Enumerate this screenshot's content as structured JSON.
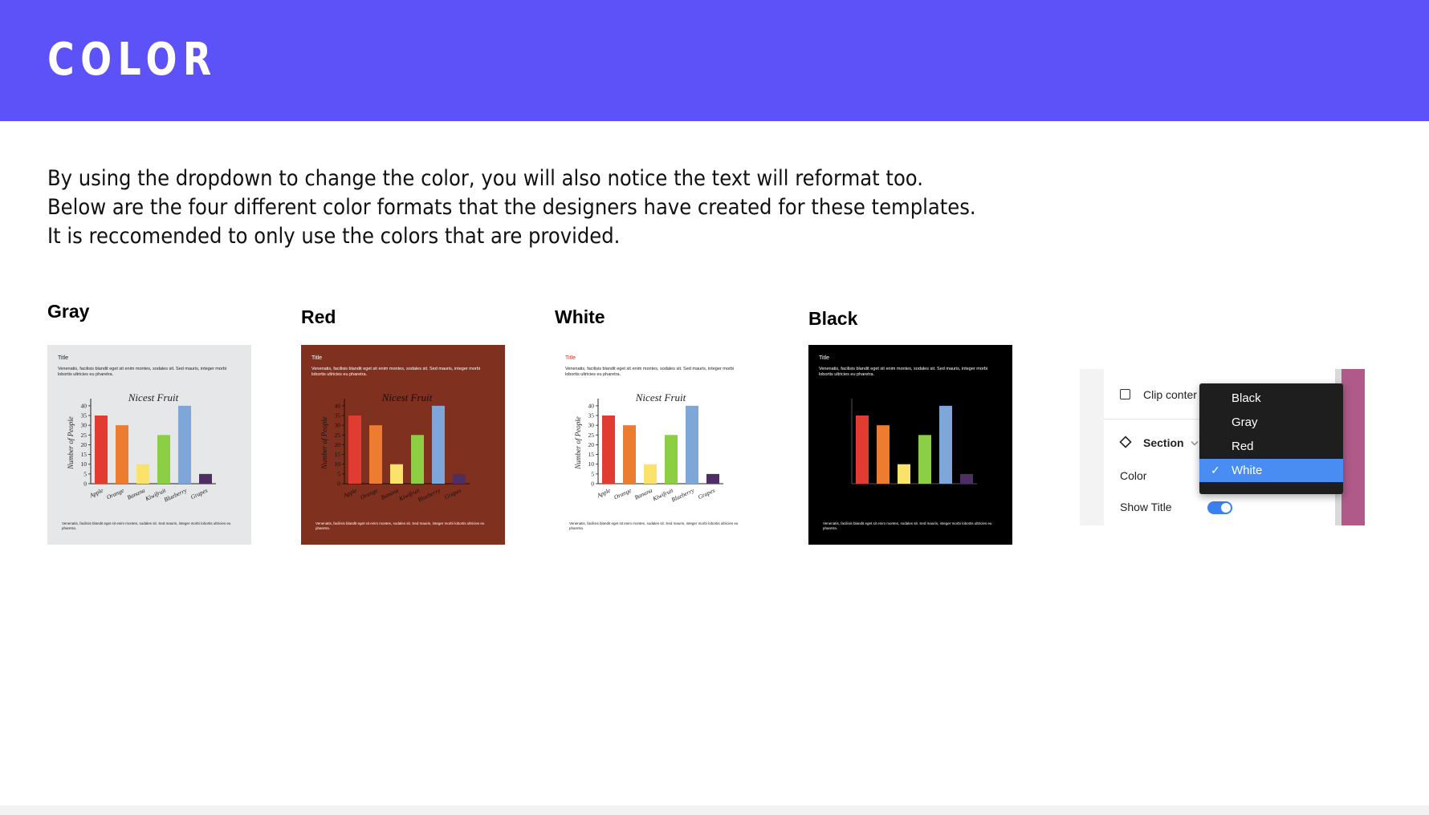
{
  "header": {
    "title": "COLOR",
    "background": "#5c52f7"
  },
  "intro": {
    "lines": [
      "By using the dropdown to change the color, you will also notice the text will reformat too.",
      "Below are the four different color formats that the designers have created for these templates.",
      "It is reccomended to only use the colors that are provided."
    ]
  },
  "variants": [
    {
      "label": "Gray",
      "background": "#e6e7e8",
      "text_color": "#222222",
      "title_color": "#222222",
      "axis_color": "#222222",
      "show_axis_labels": true
    },
    {
      "label": "Red",
      "background": "#80301f",
      "text_color": "#ffffff",
      "title_color": "#ffffff",
      "axis_color": "#1a0a05",
      "show_axis_labels": true
    },
    {
      "label": "White",
      "background": "#ffffff",
      "text_color": "#222222",
      "title_color": "#d9342b",
      "axis_color": "#222222",
      "show_axis_labels": true
    },
    {
      "label": "Black",
      "background": "#000000",
      "text_color": "#ffffff",
      "title_color": "#ffffff",
      "axis_color": "#555555",
      "show_axis_labels": false
    }
  ],
  "card_text": {
    "title": "Title",
    "description": "Venenatis, facilisis blandit eget sit enim montes, sodales sit. Sed mauris, integer morbi lobortis ultricies eu pharetra.",
    "footer": "Venenatis, facilisis blandit eget sit enim montes, sodales sit. Sed mauris, integer morbi lobortis ultricies eu pharetra."
  },
  "chart_data": {
    "type": "bar",
    "title": "Nicest Fruit",
    "xlabel": "",
    "ylabel": "Number of People",
    "categories": [
      "Apple",
      "Orange",
      "Banana",
      "Kiwifruit",
      "Blueberry",
      "Grapes"
    ],
    "values": [
      35,
      30,
      10,
      25,
      40,
      5
    ],
    "colors": [
      "#e03c31",
      "#ec7c2f",
      "#fbe26a",
      "#8ccf45",
      "#7ea6d8",
      "#4e2f63"
    ],
    "yticks": [
      0,
      5,
      10,
      15,
      20,
      25,
      30,
      35,
      40
    ],
    "ylim": [
      0,
      42
    ],
    "grid": false
  },
  "panel": {
    "clip_label": "Clip conter",
    "section_label": "Section",
    "color_label": "Color",
    "show_title_label": "Show Title",
    "show_title_on": true,
    "swatch_color": "#b05a8a",
    "dropdown": {
      "options": [
        "Black",
        "Gray",
        "Red",
        "White"
      ],
      "selected": "White",
      "check_glyph": "✓"
    }
  }
}
